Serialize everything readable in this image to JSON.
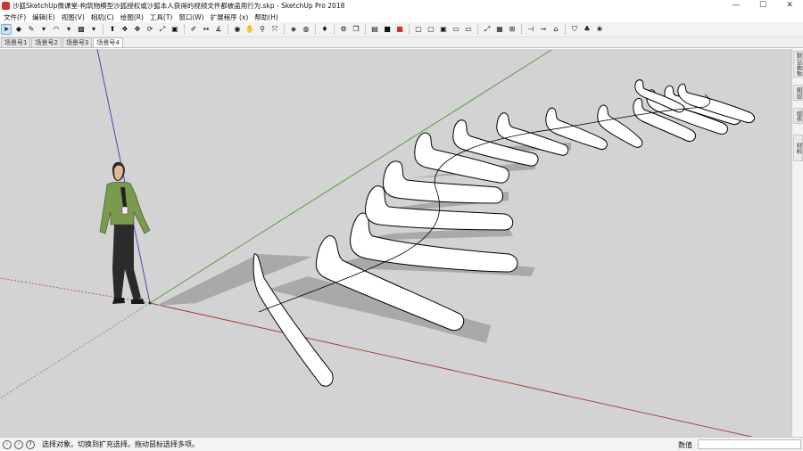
{
  "window": {
    "title": "沙狐SketchUp微课堂-构筑物模型沙狐授权或沙狐本人获得的视频文件都被盗用行为.skp - SketchUp Pro 2018",
    "minimize": "—",
    "maximize": "☐",
    "close": "✕"
  },
  "menu": [
    "文件(F)",
    "编辑(E)",
    "视图(V)",
    "相机(C)",
    "绘图(R)",
    "工具(T)",
    "窗口(W)",
    "扩展程序 (x)",
    "帮助(H)"
  ],
  "toolbar": {
    "tools": [
      {
        "name": "select-tool",
        "glyph": "➤",
        "active": true
      },
      {
        "name": "eraser-tool",
        "glyph": "◆"
      },
      {
        "name": "line-tool",
        "glyph": "✎"
      },
      {
        "name": "line-dropdown",
        "glyph": "▾"
      },
      {
        "name": "arc-tool",
        "glyph": "◠"
      },
      {
        "name": "arc-dropdown",
        "glyph": "▾"
      },
      {
        "name": "shape-tool",
        "glyph": "▩"
      },
      {
        "name": "shape-dropdown",
        "glyph": "▾"
      },
      {
        "name": "sep"
      },
      {
        "name": "push-pull-tool",
        "glyph": "⬆"
      },
      {
        "name": "follow-me-tool",
        "glyph": "❖"
      },
      {
        "name": "move-tool",
        "glyph": "✥"
      },
      {
        "name": "rotate-tool",
        "glyph": "⟳"
      },
      {
        "name": "scale-tool",
        "glyph": "⤢"
      },
      {
        "name": "offset-tool",
        "glyph": "▣"
      },
      {
        "name": "sep"
      },
      {
        "name": "tape-measure-tool",
        "glyph": "✐"
      },
      {
        "name": "dimension-tool",
        "glyph": "↔"
      },
      {
        "name": "protractor-tool",
        "glyph": "∡"
      },
      {
        "name": "sep"
      },
      {
        "name": "orbit-tool",
        "glyph": "◉"
      },
      {
        "name": "pan-tool",
        "glyph": "✋"
      },
      {
        "name": "zoom-tool",
        "glyph": "⚲"
      },
      {
        "name": "zoom-extents-tool",
        "glyph": "⤧"
      },
      {
        "name": "sep"
      },
      {
        "name": "warehouse-icon",
        "glyph": "◈"
      },
      {
        "name": "extension-warehouse-icon",
        "glyph": "◍"
      },
      {
        "name": "sep"
      },
      {
        "name": "ruby-icon",
        "glyph": "♦"
      },
      {
        "name": "sep"
      },
      {
        "name": "settings-icon",
        "glyph": "⚙"
      },
      {
        "name": "components-icon",
        "glyph": "❒"
      },
      {
        "name": "sep"
      },
      {
        "name": "layout-icon",
        "glyph": "▤"
      },
      {
        "name": "style-builder-icon",
        "glyph": "■"
      },
      {
        "name": "sketchup-red-icon",
        "glyph": "■"
      },
      {
        "name": "sep"
      },
      {
        "name": "iso-view-icon",
        "glyph": "▢"
      },
      {
        "name": "top-view-icon",
        "glyph": "▢"
      },
      {
        "name": "front-view-icon",
        "glyph": "▣"
      },
      {
        "name": "right-view-icon",
        "glyph": "▭"
      },
      {
        "name": "back-view-icon",
        "glyph": "▭"
      },
      {
        "name": "sep"
      },
      {
        "name": "x-ray-icon",
        "glyph": "⤢"
      },
      {
        "name": "wireframe-icon",
        "glyph": "▦"
      },
      {
        "name": "hidden-line-icon",
        "glyph": "⊞"
      },
      {
        "name": "sep"
      },
      {
        "name": "section-plane-icon",
        "glyph": "⊣"
      },
      {
        "name": "section-display-icon",
        "glyph": "⊸"
      },
      {
        "name": "section-fill-icon",
        "glyph": "⌂"
      },
      {
        "name": "sep"
      },
      {
        "name": "shield-icon",
        "glyph": "⛉"
      },
      {
        "name": "sandbox-icon",
        "glyph": "♣"
      },
      {
        "name": "terrain-icon",
        "glyph": "❀"
      }
    ]
  },
  "scenes": [
    {
      "label": "场景号1"
    },
    {
      "label": "场景号2"
    },
    {
      "label": "场景号3"
    },
    {
      "label": "场景号4",
      "active": true
    }
  ],
  "right_panel": {
    "tabs": [
      "默认面板",
      "图层",
      "组件",
      "材料"
    ]
  },
  "status": {
    "message": "选择对象。切换到扩充选择。拖动鼠标选择多项。",
    "measure_label": "数值",
    "measure_value": ""
  },
  "colors": {
    "viewport": "#d3d3d3",
    "red_axis": "#b03030",
    "green_axis": "#4a9a3a",
    "blue_axis": "#3a3aa8",
    "shadow": "#a9a9a9"
  }
}
